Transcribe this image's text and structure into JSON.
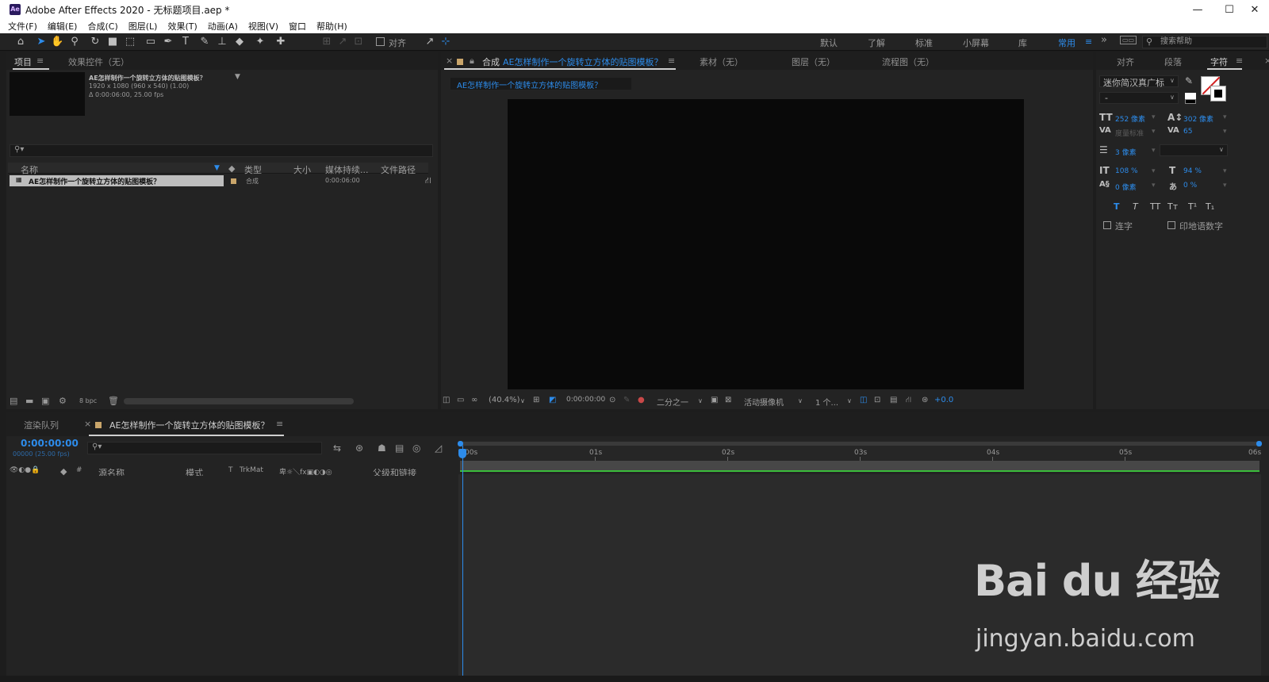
{
  "window": {
    "app_icon": "Ae",
    "title": "Adobe After Effects 2020 - 无标题项目.aep *",
    "minimize": "—",
    "maximize": "☐",
    "close": "✕"
  },
  "menu": [
    "文件(F)",
    "编辑(E)",
    "合成(C)",
    "图层(L)",
    "效果(T)",
    "动画(A)",
    "视图(V)",
    "窗口",
    "帮助(H)"
  ],
  "toolbar": {
    "align_label": "对齐",
    "workspaces": [
      "默认",
      "了解",
      "标准",
      "小屏幕",
      "库"
    ],
    "active_workspace": "常用",
    "overflow": "»",
    "search_placeholder": "搜索帮助"
  },
  "project_panel": {
    "tab_project": "项目",
    "tab_effects": "效果控件（无）",
    "comp_name": "AE怎样制作一个旋转立方体的贴图模板？",
    "comp_res": "1920 x 1080  (960 x 540) (1.00)",
    "comp_duration": "Δ 0:00:06:00, 25.00 fps",
    "columns": [
      "名称",
      "类型",
      "大小",
      "媒体持续...",
      "文件路径"
    ],
    "item": {
      "name": "AE怎样制作一个旋转立方体的贴图模板？",
      "type": "合成",
      "duration": "0:00:06:00"
    },
    "bpc": "8 bpc"
  },
  "comp_panel": {
    "tab_comp_prefix": "合成",
    "tab_comp_name": "AE怎样制作一个旋转立方体的贴图模板？",
    "tab_footage": "素材（无）",
    "tab_layer": "图层（无）",
    "tab_flow": "流程图（无）",
    "breadcrumb": "AE怎样制作一个旋转立方体的贴图模板？",
    "zoom": "(40.4%)",
    "timecode": "0:00:00:00",
    "resolution": "二分之一",
    "camera": "活动摄像机",
    "views": "1 个...",
    "exposure": "+0.0"
  },
  "character_panel": {
    "tab_align": "对齐",
    "tab_paragraph": "段落",
    "tab_character": "字符",
    "font": "迷你简汉真广标",
    "style": "-",
    "size": "252 像素",
    "leading": "302 像素",
    "kerning": "度量标准",
    "tracking": "65",
    "stroke": "3 像素",
    "vscale": "108 %",
    "hscale": "94 %",
    "baseline": "0 像素",
    "tsume": "0 %",
    "styles": [
      "T",
      "T",
      "TT",
      "Tт",
      "T¹",
      "T₁"
    ],
    "ligature": "连字",
    "hindi": "印地语数字"
  },
  "timeline": {
    "tab_render": "渲染队列",
    "tab_comp": "AE怎样制作一个旋转立方体的贴图模板？",
    "timecode": "0:00:00:00",
    "frames": "00000 (25.00 fps)",
    "columns": [
      "源名称",
      "模式",
      "T",
      "TrkMat",
      "父级和链接"
    ],
    "ticks": [
      "00s",
      "01s",
      "02s",
      "03s",
      "04s",
      "05s",
      "06s"
    ]
  },
  "watermark": {
    "logo": "Bai du 经验",
    "url": "jingyan.baidu.com"
  },
  "colors": {
    "accent": "#2d8ceb",
    "workarea": "#3bbd3b",
    "panel": "#232323"
  }
}
